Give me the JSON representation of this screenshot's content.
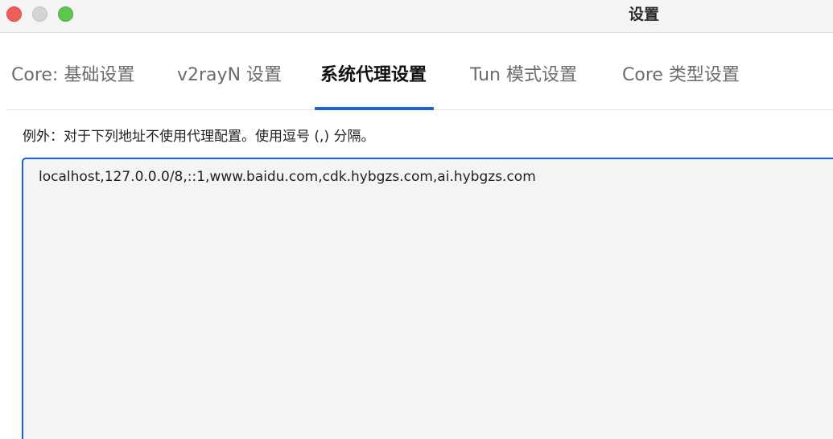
{
  "window": {
    "title": "设置"
  },
  "tabs": [
    {
      "label": "Core: 基础设置",
      "active": false
    },
    {
      "label": "v2rayN 设置",
      "active": false
    },
    {
      "label": "系统代理设置",
      "active": true
    },
    {
      "label": "Tun 模式设置",
      "active": false
    },
    {
      "label": "Core 类型设置",
      "active": false
    }
  ],
  "proxy_settings": {
    "exceptions_label": "例外：对于下列地址不使用代理配置。使用逗号 (,) 分隔。",
    "exceptions_value": "localhost,127.0.0.0/8,::1,www.baidu.com,cdk.hybgzs.com,ai.hybgzs.com"
  },
  "colors": {
    "accent": "#1a63d6",
    "close": "#ee5f57",
    "minimize": "#d4d4d4",
    "zoom": "#60c453"
  }
}
